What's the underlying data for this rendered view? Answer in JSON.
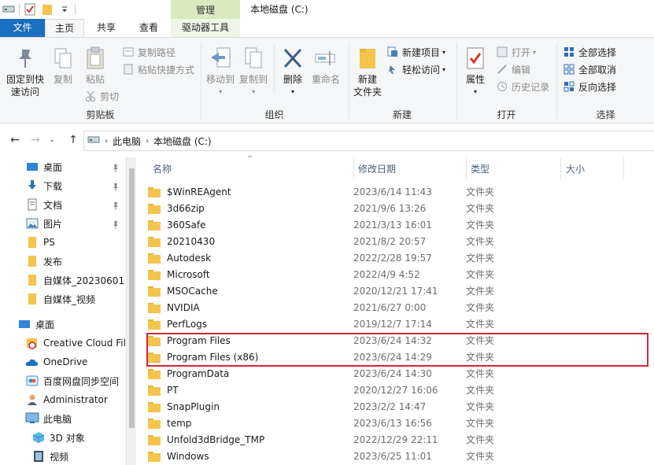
{
  "window": {
    "title": "本地磁盘 (C:)",
    "context_group": "管理"
  },
  "tabs": [
    {
      "label": "文件",
      "kind": "file"
    },
    {
      "label": "主页",
      "kind": "active"
    },
    {
      "label": "共享",
      "kind": "normal"
    },
    {
      "label": "查看",
      "kind": "normal"
    },
    {
      "label": "驱动器工具",
      "kind": "ctx"
    }
  ],
  "ribbon": {
    "clipboard": {
      "label": "剪贴板",
      "pin": "固定到快",
      "pin2": "速访问",
      "copy": "复制",
      "paste": "粘贴",
      "copy_path": "复制路径",
      "paste_shortcut": "粘贴快捷方式",
      "cut": "剪切"
    },
    "organize": {
      "label": "组织",
      "move_to": "移动到",
      "copy_to": "复制到",
      "delete": "删除",
      "rename": "重命名"
    },
    "new": {
      "label": "新建",
      "new_folder": "新建",
      "new_folder2": "文件夹",
      "new_item": "新建项目",
      "easy_access": "轻松访问"
    },
    "open": {
      "label": "打开",
      "properties": "属性",
      "open": "打开",
      "edit": "编辑",
      "history": "历史记录"
    },
    "select": {
      "label": "选择",
      "select_all": "全部选择",
      "select_none": "全部取消",
      "invert": "反向选择"
    }
  },
  "address": {
    "crumbs": [
      "此电脑",
      "本地磁盘 (C:)"
    ]
  },
  "nav": {
    "quick_access": [
      {
        "label": "桌面",
        "icon": "desktop-icon",
        "pinned": true
      },
      {
        "label": "下载",
        "icon": "download-icon",
        "pinned": true
      },
      {
        "label": "文档",
        "icon": "document-icon",
        "pinned": true
      },
      {
        "label": "图片",
        "icon": "picture-icon",
        "pinned": true
      },
      {
        "label": "PS",
        "icon": "folder-icon",
        "pinned": false
      },
      {
        "label": "发布",
        "icon": "folder-icon",
        "pinned": false
      },
      {
        "label": "自媒体_20230601",
        "icon": "folder-icon",
        "pinned": false
      },
      {
        "label": "自媒体_视频",
        "icon": "folder-icon",
        "pinned": false
      }
    ],
    "desktop_root": "桌面",
    "desktop_children": [
      {
        "label": "Creative Cloud Files",
        "icon": "creative-cloud-icon"
      },
      {
        "label": "OneDrive",
        "icon": "onedrive-icon"
      },
      {
        "label": "百度网盘同步空间",
        "icon": "baidu-netdisk-icon"
      },
      {
        "label": "Administrator",
        "icon": "user-icon"
      },
      {
        "label": "此电脑",
        "icon": "this-pc-icon"
      }
    ],
    "pc_children": [
      {
        "label": "3D 对象",
        "icon": "3d-objects-icon"
      },
      {
        "label": "视频",
        "icon": "video-icon"
      }
    ]
  },
  "columns": {
    "name": "名称",
    "date": "修改日期",
    "type": "类型",
    "size": "大小"
  },
  "files": [
    {
      "name": "$WinREAgent",
      "date": "2023/6/14 11:43",
      "type": "文件夹"
    },
    {
      "name": "3d66zip",
      "date": "2021/9/6 13:26",
      "type": "文件夹"
    },
    {
      "name": "360Safe",
      "date": "2021/3/13 16:01",
      "type": "文件夹"
    },
    {
      "name": "20210430",
      "date": "2021/8/2 20:57",
      "type": "文件夹"
    },
    {
      "name": "Autodesk",
      "date": "2022/2/28 19:57",
      "type": "文件夹"
    },
    {
      "name": "Microsoft",
      "date": "2022/4/9 4:52",
      "type": "文件夹"
    },
    {
      "name": "MSOCache",
      "date": "2020/12/21 17:41",
      "type": "文件夹"
    },
    {
      "name": "NVIDIA",
      "date": "2021/6/27 0:00",
      "type": "文件夹"
    },
    {
      "name": "PerfLogs",
      "date": "2019/12/7 17:14",
      "type": "文件夹"
    },
    {
      "name": "Program Files",
      "date": "2023/6/24 14:32",
      "type": "文件夹"
    },
    {
      "name": "Program Files (x86)",
      "date": "2023/6/24 14:29",
      "type": "文件夹"
    },
    {
      "name": "ProgramData",
      "date": "2023/6/24 14:30",
      "type": "文件夹"
    },
    {
      "name": "PT",
      "date": "2020/12/27 16:06",
      "type": "文件夹"
    },
    {
      "name": "SnapPlugin",
      "date": "2023/2/2 14:47",
      "type": "文件夹"
    },
    {
      "name": "temp",
      "date": "2023/6/13 16:56",
      "type": "文件夹"
    },
    {
      "name": "Unfold3dBridge_TMP",
      "date": "2022/12/29 22:11",
      "type": "文件夹"
    },
    {
      "name": "Windows",
      "date": "2023/6/25 11:01",
      "type": "文件夹"
    }
  ],
  "colors": {
    "accent": "#1a6fc0",
    "highlight_box": "#d02a32",
    "folder": "#f3c54d"
  }
}
